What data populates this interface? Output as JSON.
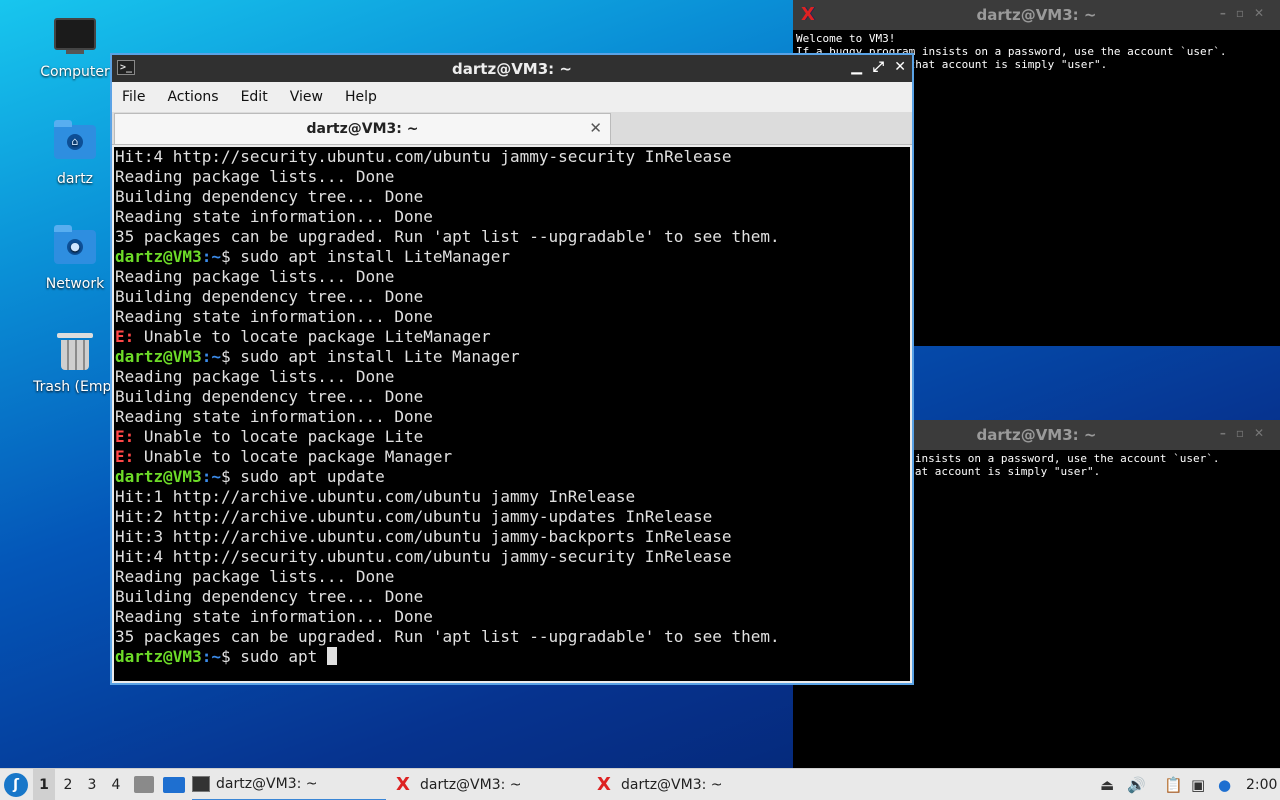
{
  "desktop": {
    "icons": [
      {
        "label": "Computer"
      },
      {
        "label": "dartz"
      },
      {
        "label": "Network"
      },
      {
        "label": "Trash (Empt"
      }
    ]
  },
  "xterm_top": {
    "title": "dartz@VM3: ~",
    "lines": [
      "Welcome to VM3!",
      "If a buggy program insists on a password, use the account `user`.",
      "The password for that account is simply \"user\"."
    ]
  },
  "xterm_bottom": {
    "title": "dartz@VM3: ~",
    "lines": [
      "If a buggy program insists on a password, use the account `user`.",
      "The password for that account is simply \"user\"."
    ]
  },
  "terminal": {
    "title": "dartz@VM3: ~",
    "menu": [
      "File",
      "Actions",
      "Edit",
      "View",
      "Help"
    ],
    "tab_label": "dartz@VM3: ~",
    "prompt_user": "dartz@VM3",
    "prompt_path": ":~",
    "lines": [
      {
        "t": "out",
        "text": "Hit:4 http://security.ubuntu.com/ubuntu jammy-security InRelease"
      },
      {
        "t": "out",
        "text": "Reading package lists... Done"
      },
      {
        "t": "out",
        "text": "Building dependency tree... Done"
      },
      {
        "t": "out",
        "text": "Reading state information... Done"
      },
      {
        "t": "out",
        "text": "35 packages can be upgraded. Run 'apt list --upgradable' to see them."
      },
      {
        "t": "cmd",
        "text": "$ sudo apt install LiteManager"
      },
      {
        "t": "out",
        "text": "Reading package lists... Done"
      },
      {
        "t": "out",
        "text": "Building dependency tree... Done"
      },
      {
        "t": "out",
        "text": "Reading state information... Done"
      },
      {
        "t": "err",
        "text": " Unable to locate package LiteManager"
      },
      {
        "t": "cmd",
        "text": "$ sudo apt install Lite Manager"
      },
      {
        "t": "out",
        "text": "Reading package lists... Done"
      },
      {
        "t": "out",
        "text": "Building dependency tree... Done"
      },
      {
        "t": "out",
        "text": "Reading state information... Done"
      },
      {
        "t": "err",
        "text": " Unable to locate package Lite"
      },
      {
        "t": "err",
        "text": " Unable to locate package Manager"
      },
      {
        "t": "cmd",
        "text": "$ sudo apt update"
      },
      {
        "t": "out",
        "text": "Hit:1 http://archive.ubuntu.com/ubuntu jammy InRelease"
      },
      {
        "t": "out",
        "text": "Hit:2 http://archive.ubuntu.com/ubuntu jammy-updates InRelease"
      },
      {
        "t": "out",
        "text": "Hit:3 http://archive.ubuntu.com/ubuntu jammy-backports InRelease"
      },
      {
        "t": "out",
        "text": "Hit:4 http://security.ubuntu.com/ubuntu jammy-security InRelease"
      },
      {
        "t": "out",
        "text": "Reading package lists... Done"
      },
      {
        "t": "out",
        "text": "Building dependency tree... Done"
      },
      {
        "t": "out",
        "text": "Reading state information... Done"
      },
      {
        "t": "out",
        "text": "35 packages can be upgraded. Run 'apt list --upgradable' to see them."
      },
      {
        "t": "input",
        "text": "$ sudo apt "
      }
    ],
    "err_prefix": "E:"
  },
  "taskbar": {
    "workspaces": [
      "1",
      "2",
      "3",
      "4"
    ],
    "active_workspace": "1",
    "tasks": [
      {
        "label": "dartz@VM3: ~",
        "icon": "terminal-icon",
        "active": true
      },
      {
        "label": "dartz@VM3: ~",
        "icon": "xterm-icon",
        "active": false
      },
      {
        "label": "dartz@VM3: ~",
        "icon": "xterm-icon",
        "active": false
      }
    ],
    "clock": "2:00"
  },
  "colors": {
    "prompt_user": "#6ddc28",
    "prompt_path": "#3a8ae8",
    "error": "#ff4747",
    "focus_border": "#5aa3e6"
  }
}
